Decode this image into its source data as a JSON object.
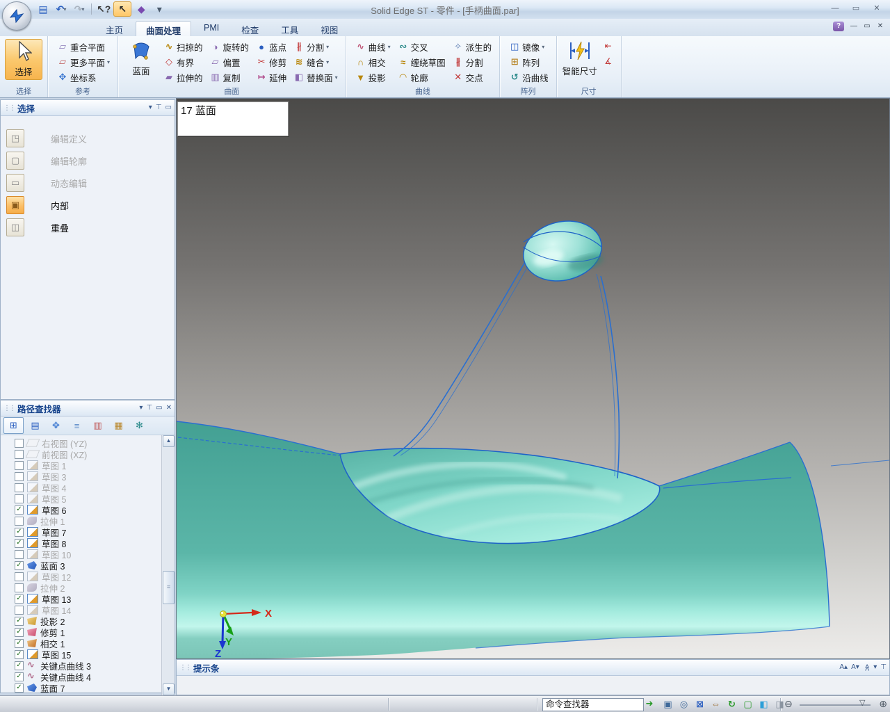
{
  "window": {
    "title": "Solid Edge ST - 零件 - [手柄曲面.par]",
    "controls": [
      {
        "name": "minimize-button",
        "glyph": "—"
      },
      {
        "name": "restore-button",
        "glyph": "▭"
      },
      {
        "name": "close-button",
        "glyph": "✕"
      }
    ],
    "doc_controls": [
      {
        "name": "doc-minimize-button",
        "glyph": "—"
      },
      {
        "name": "doc-restore-button",
        "glyph": "▭"
      },
      {
        "name": "doc-close-button",
        "glyph": "✕"
      }
    ],
    "help_icon": "?"
  },
  "quick_access": [
    {
      "name": "save-icon",
      "glyph": "▤",
      "color": "#2a5fc0"
    },
    {
      "name": "undo-icon",
      "glyph": "↶",
      "color": "#2a5fc0",
      "arrow": true
    },
    {
      "name": "redo-icon",
      "glyph": "↷",
      "color": "#aab4c0",
      "arrow": true,
      "disabled": true
    },
    {
      "name": "separator",
      "sep": true
    },
    {
      "name": "select-help-icon",
      "glyph": "↖?",
      "color": "#3a3a3a"
    },
    {
      "name": "select-tool-icon",
      "glyph": "↖",
      "color": "#2a2a2a",
      "highlight": true
    },
    {
      "name": "part-icon",
      "glyph": "◆",
      "color": "#7a4ab0"
    },
    {
      "name": "qat-more-icon",
      "glyph": "▾",
      "color": "#4a5a6c"
    }
  ],
  "tabs": [
    {
      "name": "home",
      "label": "主页"
    },
    {
      "name": "surfacing",
      "label": "曲面处理",
      "active": true
    },
    {
      "name": "pmi",
      "label": "PMI"
    },
    {
      "name": "inspect",
      "label": "检查"
    },
    {
      "name": "tools",
      "label": "工具"
    },
    {
      "name": "view",
      "label": "视图"
    }
  ],
  "ribbon": {
    "groups": [
      {
        "name": "select",
        "caption": "选择",
        "big": [
          {
            "name": "select",
            "label": "选择",
            "icon": "select-arrow",
            "active": true
          }
        ],
        "items": []
      },
      {
        "name": "reference",
        "caption": "参考",
        "items": [
          {
            "name": "coincident-plane",
            "label": "重合平面",
            "glyph": "▱",
            "color": "#8a7ab8"
          },
          {
            "name": "more-planes",
            "label": "更多平面",
            "glyph": "▱",
            "color": "#c05a5a",
            "arrow": true
          },
          {
            "name": "coordinate-system",
            "label": "坐标系",
            "glyph": "✥",
            "color": "#3f7ad1"
          }
        ]
      },
      {
        "name": "surfaces",
        "caption": "曲面",
        "big": [
          {
            "name": "bluesurf",
            "label": "蓝面",
            "icon": "bluesurf"
          }
        ],
        "items": [
          {
            "name": "swept",
            "label": "扫掠的",
            "glyph": "∿",
            "color": "#b8860b"
          },
          {
            "name": "bounded",
            "label": "有界",
            "glyph": "◇",
            "color": "#c23a3a"
          },
          {
            "name": "extruded",
            "label": "拉伸的",
            "glyph": "▰",
            "color": "#8a6ab0"
          },
          {
            "name": "revolved",
            "label": "旋转的",
            "glyph": "◑",
            "color": "#8a6ab0"
          },
          {
            "name": "offset",
            "label": "偏置",
            "glyph": "▱",
            "color": "#8a6ab0"
          },
          {
            "name": "copy",
            "label": "复制",
            "glyph": "▥",
            "color": "#8a6ab0"
          },
          {
            "name": "bluedot",
            "label": "蓝点",
            "glyph": "●",
            "color": "#2b5fc0"
          },
          {
            "name": "trim",
            "label": "修剪",
            "glyph": "✂",
            "color": "#c23a3a"
          },
          {
            "name": "extend",
            "label": "延伸",
            "glyph": "↦",
            "color": "#b04a8a"
          },
          {
            "name": "divide",
            "label": "分割",
            "glyph": "∦",
            "color": "#c23a3a",
            "arrow": true
          },
          {
            "name": "stitch",
            "label": "缝合",
            "glyph": "≋",
            "color": "#b8860b",
            "arrow": true
          },
          {
            "name": "replace-face",
            "label": "替换面",
            "glyph": "◧",
            "color": "#8a6ab0",
            "arrow": true
          }
        ]
      },
      {
        "name": "curves",
        "caption": "曲线",
        "items": [
          {
            "name": "curve",
            "label": "曲线",
            "glyph": "∿",
            "color": "#c05a7a",
            "arrow": true
          },
          {
            "name": "intersect-curve",
            "label": "相交",
            "glyph": "∩",
            "color": "#b8860b"
          },
          {
            "name": "project-curve",
            "label": "投影",
            "glyph": "▼",
            "color": "#b8860b"
          },
          {
            "name": "cross-curve",
            "label": "交叉",
            "glyph": "∾",
            "color": "#2b8a8a"
          },
          {
            "name": "wrap-sketch",
            "label": "缠绕草图",
            "glyph": "≈",
            "color": "#b8860b"
          },
          {
            "name": "contour-curve",
            "label": "轮廓",
            "glyph": "◠",
            "color": "#b8860b"
          },
          {
            "name": "derived-curve",
            "label": "派生的",
            "glyph": "✧",
            "color": "#5a7ab0"
          },
          {
            "name": "split-curve",
            "label": "分割",
            "glyph": "∦",
            "color": "#c23a3a"
          },
          {
            "name": "intersection-point",
            "label": "交点",
            "glyph": "✕",
            "color": "#c23a3a"
          }
        ]
      },
      {
        "name": "pattern",
        "caption": "阵列",
        "items": [
          {
            "name": "mirror",
            "label": "镜像",
            "glyph": "◫",
            "color": "#2b5fc0",
            "arrow": true
          },
          {
            "name": "pattern",
            "label": "阵列",
            "glyph": "⊞",
            "color": "#b8862a"
          },
          {
            "name": "along-curve",
            "label": "沿曲线",
            "glyph": "↺",
            "color": "#2b8a8a"
          }
        ]
      },
      {
        "name": "dimension",
        "caption": "尺寸",
        "big": [
          {
            "name": "smart-dimension",
            "label": "智能尺寸",
            "icon": "smart-dim"
          }
        ],
        "extras": [
          {
            "name": "distance-between",
            "glyph": "⇤"
          },
          {
            "name": "angle-between",
            "glyph": "∡"
          }
        ],
        "items": []
      }
    ]
  },
  "select_panel": {
    "title": "选择",
    "controls": [
      {
        "name": "panel-menu-icon",
        "glyph": "▾"
      },
      {
        "name": "pin-icon",
        "glyph": "⊤"
      },
      {
        "name": "float-icon",
        "glyph": "▭"
      }
    ],
    "items": [
      {
        "name": "edit-definition",
        "label": "编辑定义",
        "glyph": "◳",
        "enabled": false
      },
      {
        "name": "edit-profile",
        "label": "编辑轮廓",
        "glyph": "▢",
        "enabled": false
      },
      {
        "name": "dynamic-edit",
        "label": "动态编辑",
        "glyph": "▭",
        "enabled": false
      },
      {
        "name": "inside",
        "label": "内部",
        "glyph": "▣",
        "enabled": true,
        "active": true
      },
      {
        "name": "overlapping",
        "label": "重叠",
        "glyph": "◫",
        "enabled": true
      }
    ]
  },
  "pathfinder": {
    "title": "路径查找器",
    "controls": [
      {
        "name": "panel-menu-icon",
        "glyph": "▾"
      },
      {
        "name": "pin-icon",
        "glyph": "⊤"
      },
      {
        "name": "float-icon",
        "glyph": "▭"
      },
      {
        "name": "close-icon",
        "glyph": "✕"
      }
    ],
    "toolbar": [
      {
        "name": "pathfinder-tab-icon",
        "glyph": "⊞",
        "color": "#2b5fc0",
        "active": true
      },
      {
        "name": "library-tab-icon",
        "glyph": "▤",
        "color": "#2b5fc0"
      },
      {
        "name": "family-tab-icon",
        "glyph": "✥",
        "color": "#3f7ad1"
      },
      {
        "name": "layers-tab-icon",
        "glyph": "≡",
        "color": "#5a8ac8"
      },
      {
        "name": "sensors-tab-icon",
        "glyph": "▥",
        "color": "#c05a5a"
      },
      {
        "name": "playback-tab-icon",
        "glyph": "▦",
        "color": "#b8862a"
      },
      {
        "name": "select-tools-tab-icon",
        "glyph": "✻",
        "color": "#2b8a8a"
      }
    ],
    "items": [
      {
        "checked": false,
        "label": "右视图 (YZ)",
        "type": "plane",
        "enabled": false
      },
      {
        "checked": false,
        "label": "前视图 (XZ)",
        "type": "plane",
        "enabled": false
      },
      {
        "checked": false,
        "label": "草图 1",
        "type": "sketch",
        "enabled": false
      },
      {
        "checked": false,
        "label": "草图 3",
        "type": "sketch",
        "enabled": false
      },
      {
        "checked": false,
        "label": "草图 4",
        "type": "sketch",
        "enabled": false
      },
      {
        "checked": false,
        "label": "草图 5",
        "type": "sketch",
        "enabled": false
      },
      {
        "checked": true,
        "label": "草图 6",
        "type": "sketch",
        "enabled": true
      },
      {
        "checked": false,
        "label": "拉伸 1",
        "type": "extrude",
        "enabled": false
      },
      {
        "checked": true,
        "label": "草图 7",
        "type": "sketch",
        "enabled": true
      },
      {
        "checked": true,
        "label": "草图 8",
        "type": "sketch",
        "enabled": true
      },
      {
        "checked": false,
        "label": "草图 10",
        "type": "sketch",
        "enabled": false
      },
      {
        "checked": true,
        "label": "蓝面 3",
        "type": "bluesurf",
        "enabled": true
      },
      {
        "checked": false,
        "label": "草图 12",
        "type": "sketch",
        "enabled": false
      },
      {
        "checked": false,
        "label": "拉伸 2",
        "type": "extrude",
        "enabled": false
      },
      {
        "checked": true,
        "label": "草图 13",
        "type": "sketch",
        "enabled": true
      },
      {
        "checked": false,
        "label": "草图 14",
        "type": "sketch",
        "enabled": false
      },
      {
        "checked": true,
        "label": "投影 2",
        "type": "projection",
        "enabled": true
      },
      {
        "checked": true,
        "label": "修剪 1",
        "type": "trim",
        "enabled": true
      },
      {
        "checked": true,
        "label": "相交 1",
        "type": "intersect",
        "enabled": true
      },
      {
        "checked": true,
        "label": "草图 15",
        "type": "sketch",
        "enabled": true
      },
      {
        "checked": true,
        "label": "关键点曲线 3",
        "type": "keycurve",
        "enabled": true
      },
      {
        "checked": true,
        "label": "关键点曲线 4",
        "type": "keycurve",
        "enabled": true
      },
      {
        "checked": true,
        "label": "蓝面 7",
        "type": "bluesurf",
        "enabled": true
      }
    ]
  },
  "viewport": {
    "prompt": "17 蓝面",
    "triad": {
      "x": "X",
      "y": "Y",
      "z": "Z"
    },
    "colors": {
      "surface": "#4fae9f",
      "edge": "#2a6fd0",
      "background_top": "#4b4a48",
      "background_bottom": "#edecea"
    }
  },
  "prompt_bar": {
    "title": "提示条",
    "controls": [
      {
        "name": "font-increase-icon",
        "glyph": "A▴"
      },
      {
        "name": "font-decrease-icon",
        "glyph": "A▾"
      },
      {
        "name": "collapse-icon",
        "glyph": "≪",
        "rot": 90
      },
      {
        "name": "panel-menu-icon",
        "glyph": "▾"
      },
      {
        "name": "pin-icon",
        "glyph": "⊤"
      }
    ]
  },
  "status_bar": {
    "command_finder": "命令查找器",
    "tools": [
      {
        "name": "zoom-area-icon",
        "glyph": "▣",
        "color": "#3f6a9a"
      },
      {
        "name": "zoom-icon",
        "glyph": "◎",
        "color": "#3f6a9a"
      },
      {
        "name": "fit-icon",
        "glyph": "⊠",
        "color": "#2b5fc0"
      },
      {
        "name": "pan-icon",
        "glyph": "⇔",
        "color": "#9a6a2a"
      },
      {
        "name": "rotate-icon",
        "glyph": "↻",
        "color": "#2a9a2a"
      },
      {
        "name": "common-views-icon",
        "glyph": "▢",
        "color": "#2a9a2a"
      },
      {
        "name": "view-styles-icon",
        "glyph": "◧",
        "color": "#2b9fd8"
      },
      {
        "name": "view-overrides-icon",
        "glyph": "◨",
        "color": "#8a94a0"
      }
    ],
    "zoom_slider": {
      "minus": "⊖",
      "plus": "⊕",
      "thumb": "▽"
    }
  }
}
